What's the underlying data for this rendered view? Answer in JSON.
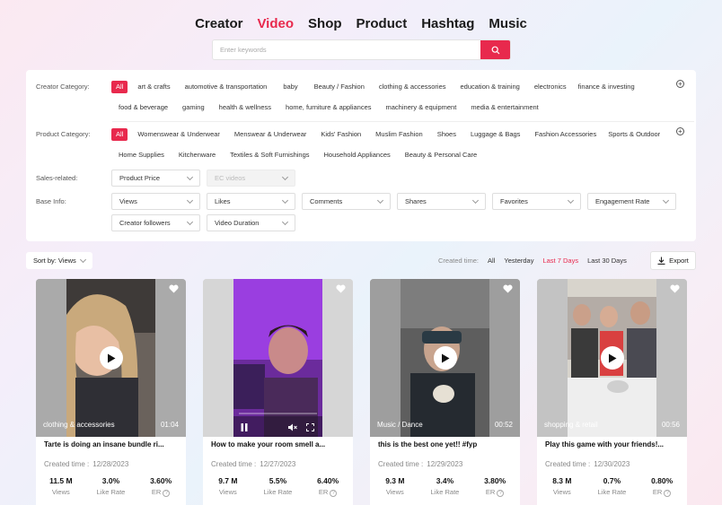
{
  "nav": {
    "tabs": [
      {
        "label": "Creator"
      },
      {
        "label": "Video"
      },
      {
        "label": "Shop"
      },
      {
        "label": "Product"
      },
      {
        "label": "Hashtag"
      },
      {
        "label": "Music"
      }
    ],
    "active_tab": "Video",
    "accent_color": "#e8294d"
  },
  "search": {
    "placeholder": "Enter keywords",
    "value": "",
    "icon": "search-icon"
  },
  "filters": {
    "creator_category": {
      "label": "Creator Category:",
      "options": [
        "All",
        "art & crafts",
        "automotive & transportation",
        "baby",
        "Beauty / Fashion",
        "clothing & accessories",
        "education & training",
        "electronics",
        "finance & investing",
        "food & beverage",
        "gaming",
        "health & wellness",
        "home, furniture & appliances",
        "machinery & equipment",
        "media & entertainment"
      ],
      "selected": "All"
    },
    "product_category": {
      "label": "Product Category:",
      "options": [
        "All",
        "Womenswear & Underwear",
        "Menswear & Underwear",
        "Kids' Fashion",
        "Muslim Fashion",
        "Shoes",
        "Luggage & Bags",
        "Fashion Accessories",
        "Sports & Outdoor",
        "Home Supplies",
        "Kitchenware",
        "Textiles & Soft Furnishings",
        "Household Appliances",
        "Beauty & Personal Care"
      ],
      "selected": "All"
    },
    "sales_related": {
      "label": "Sales-related:",
      "dropdowns": [
        "Product Price",
        "EC videos"
      ]
    },
    "base_info": {
      "label": "Base Info:",
      "dropdowns": [
        "Views",
        "Likes",
        "Comments",
        "Shares",
        "Favorites",
        "Engagement Rate",
        "Creator followers",
        "Video Duration"
      ]
    }
  },
  "toolbar": {
    "sort_label": "Sort by: Views",
    "created_time_label": "Created time:",
    "time_options": [
      "All",
      "Yesterday",
      "Last 7 Days",
      "Last 30 Days"
    ],
    "time_selected": "Last 7 Days",
    "export_label": "Export"
  },
  "videos": [
    {
      "category": "clothing & accessories",
      "duration": "01:04",
      "title": "Tarte is doing an insane bundle ri...",
      "created_label": "Created time :",
      "created": "12/28/2023",
      "views": "11.5 M",
      "views_label": "Views",
      "like_rate": "3.0%",
      "like_rate_label": "Like Rate",
      "er": "3.60%",
      "er_label": "ER"
    },
    {
      "category": "",
      "duration": "",
      "title": "How to make your room smell a...",
      "created_label": "Created time :",
      "created": "12/27/2023",
      "views": "9.7 M",
      "views_label": "Views",
      "like_rate": "5.5%",
      "like_rate_label": "Like Rate",
      "er": "6.40%",
      "er_label": "ER"
    },
    {
      "category": "Music / Dance",
      "duration": "00:52",
      "title": "this is the best one yet!! #fyp",
      "created_label": "Created time :",
      "created": "12/29/2023",
      "views": "9.3 M",
      "views_label": "Views",
      "like_rate": "3.4%",
      "like_rate_label": "Like Rate",
      "er": "3.80%",
      "er_label": "ER"
    },
    {
      "category": "shopping & retail",
      "duration": "00:56",
      "title": "Play this game with your friends!...",
      "created_label": "Created time :",
      "created": "12/30/2023",
      "views": "8.3 M",
      "views_label": "Views",
      "like_rate": "0.7%",
      "like_rate_label": "Like Rate",
      "er": "0.80%",
      "er_label": "ER"
    }
  ]
}
